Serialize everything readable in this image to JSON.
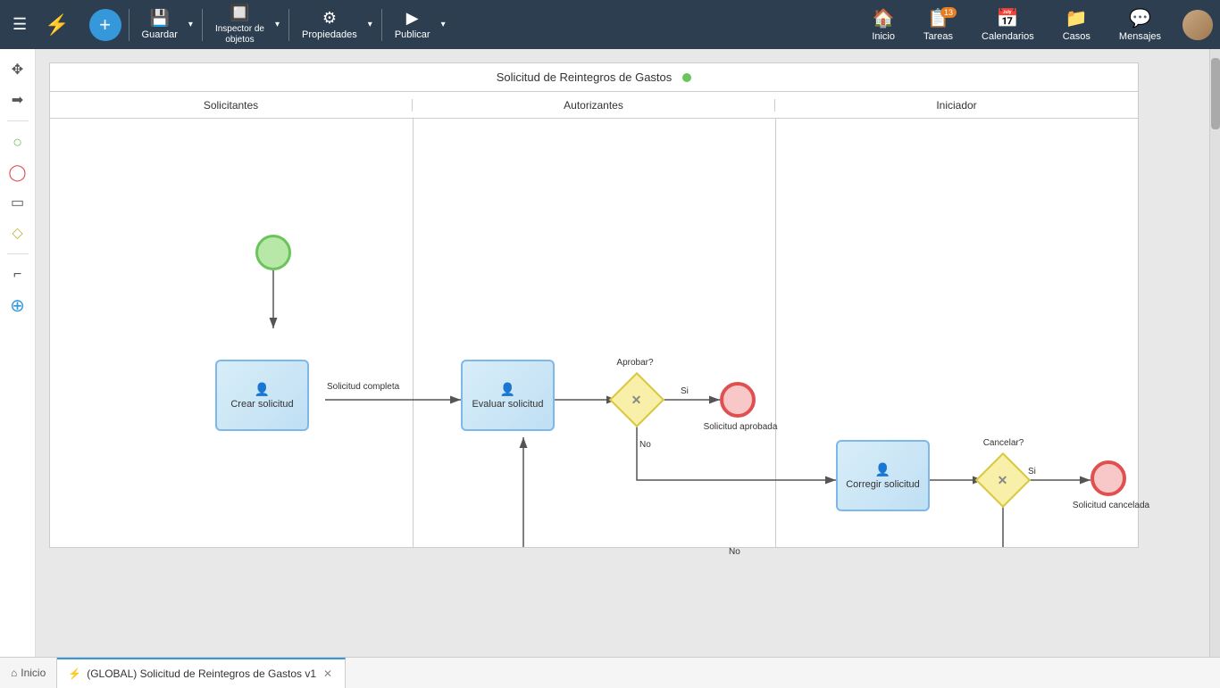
{
  "toolbar": {
    "hamburger_label": "☰",
    "logo_icon": "⚡",
    "add_icon": "+",
    "save_label": "Guardar",
    "inspector_label": "Inspector de\nobjetos",
    "properties_label": "Propiedades",
    "publish_label": "Publicar"
  },
  "nav": {
    "inicio_label": "Inicio",
    "tareas_label": "Tareas",
    "tareas_badge": "13",
    "calendarios_label": "Calendarios",
    "casos_label": "Casos",
    "mensajes_label": "Mensajes"
  },
  "diagram": {
    "title": "Solicitud de Reintegros de Gastos",
    "lanes": [
      {
        "label": "Solicitantes"
      },
      {
        "label": "Autorizantes"
      },
      {
        "label": "Iniciador"
      }
    ],
    "elements": {
      "start_event": {
        "label": ""
      },
      "task_crear": {
        "label": "Crear solicitud"
      },
      "flow_label_1": "Solicitud completa",
      "task_evaluar": {
        "label": "Evaluar solicitud"
      },
      "gateway_aprobar": {
        "label": "Aprobar?"
      },
      "flow_si_1": "Si",
      "flow_no_1": "No",
      "end_event_1": {
        "label": "Solicitud aprobada"
      },
      "task_corregir": {
        "label": "Corregir solicitud"
      },
      "gateway_cancelar": {
        "label": "Cancelar?"
      },
      "flow_si_2": "Si",
      "flow_no_2": "No",
      "end_event_2": {
        "label": "Solicitud cancelada"
      }
    }
  },
  "bottom_tabs": {
    "home_icon": "⌂",
    "home_label": "Inicio",
    "tab_icon": "⚡",
    "tab_label": "(GLOBAL) Solicitud de Reintegros de Gastos v1"
  },
  "left_tools": [
    {
      "icon": "✥",
      "name": "move-tool"
    },
    {
      "icon": "➡",
      "name": "arrow-tool"
    },
    {
      "icon": "○",
      "name": "start-event-tool"
    },
    {
      "icon": "◯",
      "name": "end-event-tool"
    },
    {
      "icon": "▭",
      "name": "task-tool"
    },
    {
      "icon": "◇",
      "name": "gateway-tool"
    },
    {
      "icon": "⌐",
      "name": "sequence-tool"
    },
    {
      "icon": "⊕",
      "name": "add-tool"
    }
  ]
}
